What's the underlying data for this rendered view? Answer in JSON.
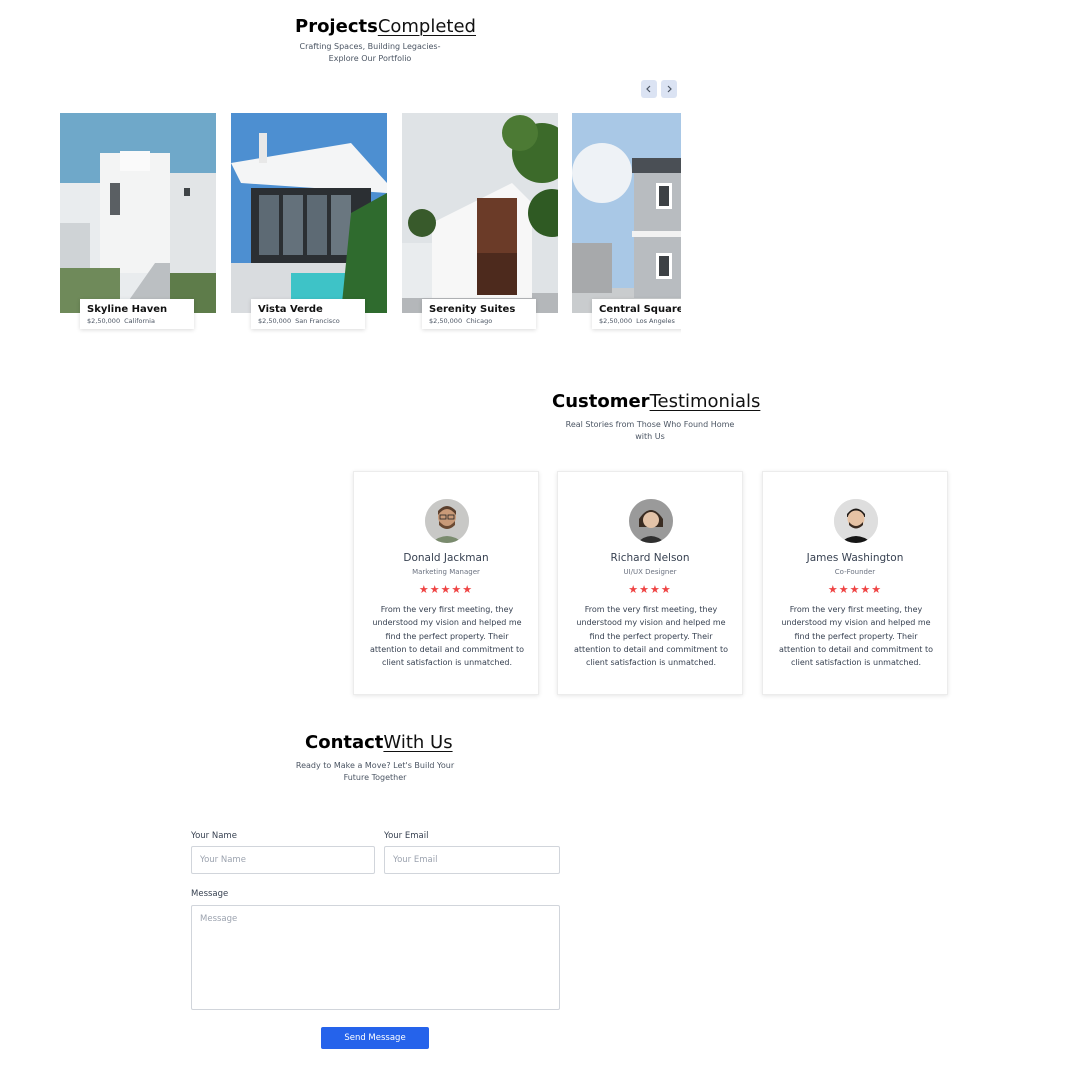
{
  "projects": {
    "title_strong": "Projects",
    "title_light": "Completed",
    "subtitle": "Crafting Spaces, Building Legacies-Explore Our Portfolio",
    "prev_icon": "chevron-left-icon",
    "next_icon": "chevron-right-icon",
    "items": [
      {
        "name": "Skyline Haven",
        "price": "$2,50,000",
        "location": "California"
      },
      {
        "name": "Vista Verde",
        "price": "$2,50,000",
        "location": "San Francisco"
      },
      {
        "name": "Serenity Suites",
        "price": "$2,50,000",
        "location": "Chicago"
      },
      {
        "name": "Central Square",
        "price": "$2,50,000",
        "location": "Los Angeles"
      }
    ]
  },
  "testimonials": {
    "title_strong": "Customer",
    "title_light": "Testimonials",
    "subtitle": "Real Stories from Those Who Found Home with Us",
    "items": [
      {
        "name": "Donald Jackman",
        "role": "Marketing Manager",
        "stars": "★★★★★",
        "rating": 5,
        "text": "From the very first meeting, they understood my vision and helped me find the perfect property. Their attention to detail and commitment to client satisfaction is unmatched."
      },
      {
        "name": "Richard Nelson",
        "role": "UI/UX Designer",
        "stars": "★★★★",
        "rating": 4,
        "text": "From the very first meeting, they understood my vision and helped me find the perfect property. Their attention to detail and commitment to client satisfaction is unmatched."
      },
      {
        "name": "James Washington",
        "role": "Co-Founder",
        "stars": "★★★★★",
        "rating": 5,
        "text": "From the very first meeting, they understood my vision and helped me find the perfect property. Their attention to detail and commitment to client satisfaction is unmatched."
      }
    ]
  },
  "contact": {
    "title_strong": "Contact",
    "title_light": "With Us",
    "subtitle": "Ready to Make a Move? Let's Build Your Future Together",
    "name_label": "Your Name",
    "name_placeholder": "Your Name",
    "email_label": "Your Email",
    "email_placeholder": "Your Email",
    "message_label": "Message",
    "message_placeholder": "Message",
    "submit_label": "Send Message"
  },
  "colors": {
    "accent": "#2563eb",
    "star": "#ef4444",
    "nav_button": "#dbe3f3"
  }
}
